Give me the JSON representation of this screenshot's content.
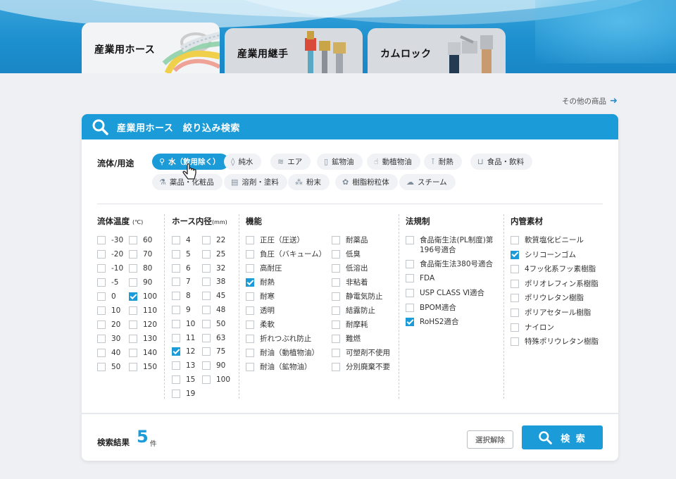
{
  "tabs": [
    {
      "label": "産業用ホース",
      "active": true
    },
    {
      "label": "産業用継手",
      "active": false
    },
    {
      "label": "カムロック",
      "active": false
    }
  ],
  "other_products_link": "その他の商品",
  "panel": {
    "title": "産業用ホース　絞り込み検索"
  },
  "fluid": {
    "label": "流体/用途",
    "chips": [
      {
        "label": "水（飲用除く）",
        "icon": "faucet-icon",
        "selected": true
      },
      {
        "label": "純水",
        "icon": "droplet-icon",
        "selected": false
      },
      {
        "label": "エア",
        "icon": "wind-icon",
        "selected": false
      },
      {
        "label": "鉱物油",
        "icon": "oil-can-icon",
        "selected": false
      },
      {
        "label": "動植物油",
        "icon": "plant-oil-icon",
        "selected": false
      },
      {
        "label": "耐熱",
        "icon": "thermometer-icon",
        "selected": false
      },
      {
        "label": "食品・飲料",
        "icon": "cup-icon",
        "selected": false
      },
      {
        "label": "薬品・化粧品",
        "icon": "flask-icon",
        "selected": false
      },
      {
        "label": "溶剤・塗料",
        "icon": "paint-icon",
        "selected": false
      },
      {
        "label": "粉末",
        "icon": "powder-icon",
        "selected": false
      },
      {
        "label": "樹脂粉粒体",
        "icon": "granule-icon",
        "selected": false
      },
      {
        "label": "スチーム",
        "icon": "steam-icon",
        "selected": false
      }
    ]
  },
  "temperature": {
    "title": "流体温度",
    "unit": "(℃)",
    "left": [
      {
        "label": "-30",
        "checked": false
      },
      {
        "label": "-20",
        "checked": false
      },
      {
        "label": "-10",
        "checked": false
      },
      {
        "label": "-5",
        "checked": false
      },
      {
        "label": "0",
        "checked": false
      },
      {
        "label": "10",
        "checked": false
      },
      {
        "label": "20",
        "checked": false
      },
      {
        "label": "30",
        "checked": false
      },
      {
        "label": "40",
        "checked": false
      },
      {
        "label": "50",
        "checked": false
      }
    ],
    "right": [
      {
        "label": "60",
        "checked": false
      },
      {
        "label": "70",
        "checked": false
      },
      {
        "label": "80",
        "checked": false
      },
      {
        "label": "90",
        "checked": false
      },
      {
        "label": "100",
        "checked": true
      },
      {
        "label": "110",
        "checked": false
      },
      {
        "label": "120",
        "checked": false
      },
      {
        "label": "130",
        "checked": false
      },
      {
        "label": "140",
        "checked": false
      },
      {
        "label": "150",
        "checked": false
      }
    ]
  },
  "diameter": {
    "title": "ホース内径",
    "unit": "(mm)",
    "left": [
      {
        "label": "4",
        "checked": false
      },
      {
        "label": "5",
        "checked": false
      },
      {
        "label": "6",
        "checked": false
      },
      {
        "label": "7",
        "checked": false
      },
      {
        "label": "8",
        "checked": false
      },
      {
        "label": "9",
        "checked": false
      },
      {
        "label": "10",
        "checked": false
      },
      {
        "label": "11",
        "checked": false
      },
      {
        "label": "12",
        "checked": true
      },
      {
        "label": "13",
        "checked": false
      },
      {
        "label": "15",
        "checked": false
      },
      {
        "label": "19",
        "checked": false
      }
    ],
    "right": [
      {
        "label": "22",
        "checked": false
      },
      {
        "label": "25",
        "checked": false
      },
      {
        "label": "32",
        "checked": false
      },
      {
        "label": "38",
        "checked": false
      },
      {
        "label": "45",
        "checked": false
      },
      {
        "label": "48",
        "checked": false
      },
      {
        "label": "50",
        "checked": false
      },
      {
        "label": "63",
        "checked": false
      },
      {
        "label": "75",
        "checked": false
      },
      {
        "label": "90",
        "checked": false
      },
      {
        "label": "100",
        "checked": false
      }
    ]
  },
  "function": {
    "title": "機能",
    "left": [
      {
        "label": "正圧（圧送）",
        "checked": false
      },
      {
        "label": "負圧（バキューム）",
        "checked": false
      },
      {
        "label": "高耐圧",
        "checked": false
      },
      {
        "label": "耐熱",
        "checked": true
      },
      {
        "label": "耐寒",
        "checked": false
      },
      {
        "label": "透明",
        "checked": false
      },
      {
        "label": "柔軟",
        "checked": false
      },
      {
        "label": "折れつぶれ防止",
        "checked": false
      },
      {
        "label": "耐油（動植物油）",
        "checked": false
      },
      {
        "label": "耐油（鉱物油）",
        "checked": false
      }
    ],
    "right": [
      {
        "label": "耐薬品",
        "checked": false
      },
      {
        "label": "低臭",
        "checked": false
      },
      {
        "label": "低溶出",
        "checked": false
      },
      {
        "label": "非粘着",
        "checked": false
      },
      {
        "label": "静電気防止",
        "checked": false
      },
      {
        "label": "結露防止",
        "checked": false
      },
      {
        "label": "耐摩耗",
        "checked": false
      },
      {
        "label": "難燃",
        "checked": false
      },
      {
        "label": "可塑剤不使用",
        "checked": false
      },
      {
        "label": "分別廃棄不要",
        "checked": false
      }
    ]
  },
  "regulation": {
    "title": "法規制",
    "items": [
      {
        "label": "食品衛生法(PL制度)第",
        "label2": "196号適合",
        "checked": false
      },
      {
        "label": "食品衛生法380号適合",
        "checked": false
      },
      {
        "label": "FDA",
        "checked": false
      },
      {
        "label": "USP CLASS Ⅵ適合",
        "checked": false
      },
      {
        "label": "BPOM適合",
        "checked": false
      },
      {
        "label": "RoHS2適合",
        "checked": true
      }
    ]
  },
  "material": {
    "title": "内管素材",
    "items": [
      {
        "label": "軟質塩化ビニール",
        "checked": false
      },
      {
        "label": "シリコーンゴム",
        "checked": true
      },
      {
        "label": "4フッ化系フッ素樹脂",
        "checked": false
      },
      {
        "label": "ポリオレフィン系樹脂",
        "checked": false
      },
      {
        "label": "ポリウレタン樹脂",
        "checked": false
      },
      {
        "label": "ポリアセタール樹脂",
        "checked": false
      },
      {
        "label": "ナイロン",
        "checked": false
      },
      {
        "label": "特殊ポリウレタン樹脂",
        "checked": false
      }
    ]
  },
  "result": {
    "label": "検索結果",
    "count": "5",
    "unit": "件"
  },
  "buttons": {
    "clear": "選択解除",
    "search": "検 索"
  },
  "colors": {
    "accent": "#1b9bd7",
    "banner": "#1d90cf",
    "tab_inactive": "#d7dadf"
  }
}
